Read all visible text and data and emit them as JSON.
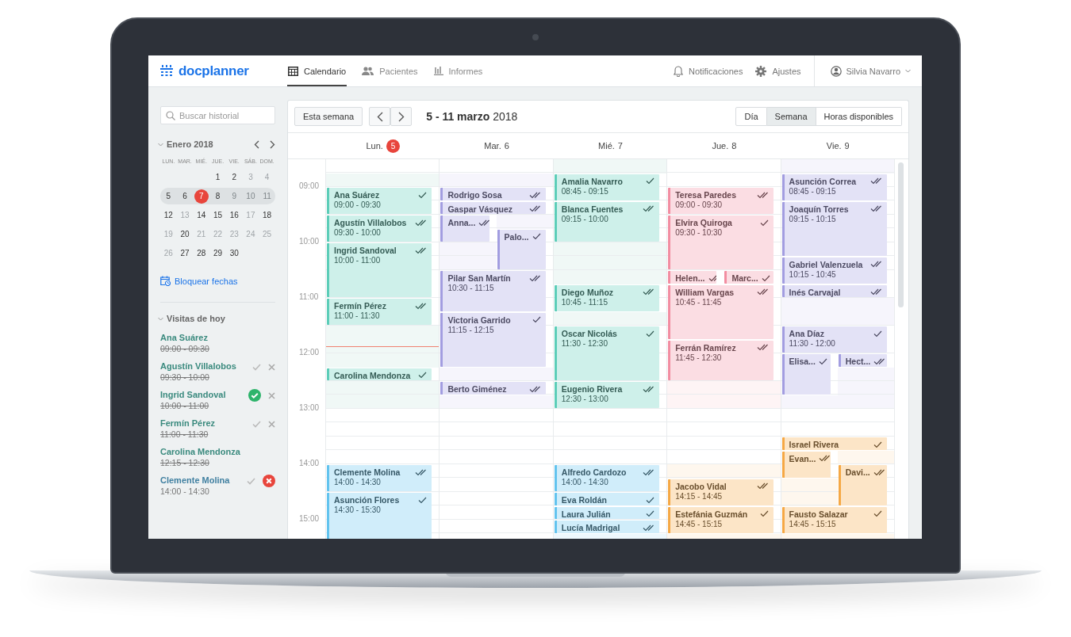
{
  "header": {
    "logo": "docplanner",
    "nav": [
      {
        "label": "Calendario",
        "selected": true
      },
      {
        "label": "Pacientes",
        "selected": false
      },
      {
        "label": "Informes",
        "selected": false
      }
    ],
    "notifications": "Notificaciones",
    "settings": "Ajustes",
    "user": "Silvia Navarro"
  },
  "sidebar": {
    "search": {
      "placeholder": "Buscar historial"
    },
    "month": "Enero 2018",
    "weekdays": [
      "LUN.",
      "MAR.",
      "MIÉ.",
      "JUE.",
      "VIE.",
      "SÁB.",
      "DOM."
    ],
    "weeks": [
      {
        "current": false,
        "days": [
          {
            "d": "1",
            "muted": false,
            "selected": false
          },
          {
            "d": "2",
            "muted": false,
            "selected": false
          },
          {
            "d": "3",
            "muted": true,
            "selected": false
          },
          {
            "d": "4",
            "muted": true,
            "selected": false
          }
        ]
      },
      {
        "current": true,
        "days": [
          {
            "d": "5",
            "muted": false,
            "selected": false
          },
          {
            "d": "6",
            "muted": false,
            "selected": false
          },
          {
            "d": "7",
            "muted": false,
            "selected": true
          },
          {
            "d": "8",
            "muted": false,
            "selected": false
          },
          {
            "d": "9",
            "muted": true,
            "selected": false
          },
          {
            "d": "10",
            "muted": true,
            "selected": false
          },
          {
            "d": "11",
            "muted": true,
            "selected": false
          }
        ]
      },
      {
        "current": false,
        "days": [
          {
            "d": "12",
            "muted": false,
            "selected": false
          },
          {
            "d": "13",
            "muted": true,
            "selected": false
          },
          {
            "d": "14",
            "muted": false,
            "selected": false
          },
          {
            "d": "15",
            "muted": false,
            "selected": false
          },
          {
            "d": "16",
            "muted": false,
            "selected": false
          },
          {
            "d": "17",
            "muted": true,
            "selected": false
          },
          {
            "d": "18",
            "muted": false,
            "selected": false
          }
        ]
      },
      {
        "current": false,
        "days": [
          {
            "d": "19",
            "muted": true,
            "selected": false
          },
          {
            "d": "20",
            "muted": false,
            "selected": false
          },
          {
            "d": "21",
            "muted": true,
            "selected": false
          },
          {
            "d": "22",
            "muted": true,
            "selected": false
          },
          {
            "d": "23",
            "muted": true,
            "selected": false
          },
          {
            "d": "24",
            "muted": true,
            "selected": false
          },
          {
            "d": "25",
            "muted": true,
            "selected": false
          }
        ]
      },
      {
        "current": false,
        "days": [
          {
            "d": "26",
            "muted": true,
            "selected": false
          },
          {
            "d": "27",
            "muted": false,
            "selected": false
          },
          {
            "d": "28",
            "muted": false,
            "selected": false
          },
          {
            "d": "29",
            "muted": false,
            "selected": false
          },
          {
            "d": "30",
            "muted": false,
            "selected": false
          }
        ]
      }
    ],
    "block_dates": "Bloquear fechas",
    "visits_title": "Visitas de hoy",
    "visits": [
      {
        "name": "Ana Suárez",
        "time": "09:00 - 09:30",
        "done": true,
        "actions": false,
        "color": "#3a8a7e"
      },
      {
        "name": "Agustín Villalobos",
        "time": "09:30 - 10:00",
        "done": true,
        "actions": true,
        "accepted": false,
        "rejected": false,
        "color": "#3a8a7e"
      },
      {
        "name": "Ingrid Sandoval",
        "time": "10:00 - 11:00",
        "done": true,
        "actions": true,
        "accepted": true,
        "rejected": false,
        "color": "#3a8a7e"
      },
      {
        "name": "Fermín Pérez",
        "time": "11:00 - 11:30",
        "done": true,
        "actions": true,
        "accepted": false,
        "rejected": false,
        "color": "#3a8a7e"
      },
      {
        "name": "Carolina Mendonza",
        "time": "12:15 - 12:30",
        "done": true,
        "actions": false,
        "color": "#3a8a7e"
      },
      {
        "name": "Clemente Molina",
        "time": "14:00 - 14:30",
        "done": false,
        "actions": true,
        "accepted": false,
        "rejected": true,
        "color": "#3f7fa0"
      }
    ]
  },
  "calendar": {
    "this_week": "Esta semana",
    "title": "**5 - 11 marzo** 2018",
    "views": [
      {
        "label": "Día",
        "selected": false
      },
      {
        "label": "Semana",
        "selected": true
      },
      {
        "label": "Horas disponibles",
        "selected": false
      }
    ],
    "hours": [
      "09:00",
      "10:00",
      "11:00",
      "12:00",
      "13:00",
      "14:00",
      "15:00"
    ],
    "days": [
      {
        "label": "Lun.",
        "date": "5",
        "highlighted": true,
        "slots": [
          {
            "kind": "gap"
          },
          {
            "kind": "gap",
            "color": "#f0f8f6"
          },
          {
            "kind": "wide",
            "name": "Ana Suárez",
            "time": "09:00 - 09:30",
            "double_check": false,
            "color": "#5ccdb8"
          },
          {
            "kind": "wide",
            "name": "Agustín Villalobos",
            "time": "09:30 - 10:00",
            "double_check": true,
            "color": "#5ccdb8"
          },
          {
            "kind": "wide",
            "name": "Ingrid Sandoval",
            "time": "10:00 - 11:00",
            "double_check": true,
            "color": "#5ccdb8"
          },
          {
            "kind": "wide",
            "name": "Fermín Pérez",
            "time": "11:00 - 11:30",
            "double_check": true,
            "color": "#5ccdb8"
          },
          {
            "kind": "gap",
            "color": "#f0f8f6"
          },
          {
            "kind": "nowline",
            "color": "#f0f8f6"
          },
          {
            "kind": "gap",
            "color": "#f0f8f6"
          },
          {
            "kind": "wide",
            "name": "Carolina Mendonza",
            "double_check": false,
            "color": "#5ccdb8"
          },
          {
            "kind": "gap",
            "color": "#f0f8f6"
          },
          {
            "kind": "gap",
            "color": "#f0f8f6"
          },
          {
            "kind": "gap"
          },
          {
            "kind": "gap"
          },
          {
            "kind": "gap"
          },
          {
            "kind": "gap"
          },
          {
            "kind": "wide",
            "name": "Clemente Molina",
            "time": "14:00 - 14:30",
            "double_check": true,
            "color": "#62c3ee"
          },
          {
            "kind": "wide",
            "name": "Asunción Flores",
            "time": "14:30 - 15:30",
            "double_check": false,
            "color": "#62c3ee"
          }
        ]
      },
      {
        "label": "Mar.",
        "date": "6",
        "highlighted": false,
        "slots": [
          {
            "kind": "gap"
          },
          {
            "kind": "gap",
            "color": "#f6f5fc"
          },
          {
            "kind": "wide",
            "name": "Rodrigo Sosa",
            "double_check": true,
            "color": "#a29de0"
          },
          {
            "kind": "wide",
            "name": "Gaspar Vásquez",
            "double_check": true,
            "color": "#a29de0"
          },
          {
            "kind": "narrow-double",
            "name": "Anna...",
            "double_check": true,
            "color": "#a29de0"
          },
          {
            "kind": "halfgap",
            "color": "#f6f5fc"
          },
          {
            "kind": "narrow-triple",
            "name": "Palo...",
            "double_check": false,
            "color": "#a29de0"
          },
          {
            "kind": "halfgap",
            "color": "#f6f5fc"
          },
          {
            "kind": "halfgap",
            "color": "#f6f5fc"
          },
          {
            "kind": "wide",
            "name": "Pilar San Martín",
            "time": "10:30 - 11:15",
            "double_check": true,
            "color": "#a29de0"
          },
          {
            "kind": "wide",
            "name": "Victoria Garrido",
            "time": "11:15 - 12:15",
            "double_check": false,
            "color": "#a29de0"
          },
          {
            "kind": "gap",
            "color": "#f6f5fc"
          },
          {
            "kind": "wide",
            "name": "Berto Giménez",
            "double_check": true,
            "color": "#a29de0"
          },
          {
            "kind": "gap",
            "color": "#f6f5fc"
          }
        ]
      },
      {
        "label": "Mié.",
        "date": "7",
        "highlighted": false,
        "slots": [
          {
            "kind": "gap",
            "color": "#f0f8f6"
          },
          {
            "kind": "wide",
            "name": "Amalia Navarro",
            "time": "08:45 - 09:15",
            "double_check": false,
            "color": "#5ccdb8"
          },
          {
            "kind": "wide",
            "name": "Blanca Fuentes",
            "time": "09:15 - 10:00",
            "double_check": true,
            "color": "#5ccdb8"
          },
          {
            "kind": "gap",
            "color": "#f0f8f6"
          },
          {
            "kind": "gap",
            "color": "#f0f8f6"
          },
          {
            "kind": "gap",
            "color": "#f0f8f6"
          },
          {
            "kind": "wide",
            "name": "Diego Muñoz",
            "time": "10:45 - 11:15",
            "double_check": true,
            "color": "#5ccdb8"
          },
          {
            "kind": "gap",
            "color": "#f0f8f6"
          },
          {
            "kind": "wide",
            "name": "Oscar Nicolás",
            "time": "11:30 - 12:30",
            "double_check": false,
            "color": "#5ccdb8"
          },
          {
            "kind": "wide",
            "name": "Eugenio Rivera",
            "time": "12:30 - 13:00",
            "double_check": true,
            "color": "#5ccdb8"
          },
          {
            "kind": "gap"
          },
          {
            "kind": "gap"
          },
          {
            "kind": "gap"
          },
          {
            "kind": "gap"
          },
          {
            "kind": "wide",
            "name": "Alfredo Cardozo",
            "time": "14:00 - 14:30",
            "double_check": true,
            "color": "#62c3ee"
          },
          {
            "kind": "wide",
            "name": "Eva Roldán",
            "double_check": false,
            "color": "#62c3ee"
          },
          {
            "kind": "wide",
            "name": "Laura Julián",
            "double_check": false,
            "color": "#62c3ee"
          },
          {
            "kind": "wide",
            "name": "Lucía Madrigal",
            "double_check": true,
            "color": "#62c3ee"
          },
          {
            "kind": "gap",
            "color": "#eef8fd"
          }
        ]
      },
      {
        "label": "Jue.",
        "date": "8",
        "highlighted": false,
        "slots": [
          {
            "kind": "gap"
          },
          {
            "kind": "gap"
          },
          {
            "kind": "wide",
            "name": "Teresa Paredes",
            "time": "09:00 - 09:30",
            "double_check": true,
            "color": "#f28da1"
          },
          {
            "kind": "wide",
            "name": "Elvira Quiroga",
            "time": "09:30 - 10:30",
            "double_check": false,
            "color": "#f28da1"
          },
          {
            "kind": "narrow",
            "name": "Helen...",
            "double_check": true,
            "color": "#f28da1"
          },
          {
            "kind": "narrow",
            "name": "Marc...",
            "double_check": false,
            "color": "#f28da1"
          },
          {
            "kind": "wide",
            "name": "William Vargas",
            "time": "10:45 - 11:45",
            "double_check": true,
            "color": "#f28da1"
          },
          {
            "kind": "wide",
            "name": "Ferrán Ramírez",
            "time": "11:45 - 12:30",
            "double_check": true,
            "color": "#f28da1"
          },
          {
            "kind": "gap",
            "color": "#fef4f5"
          },
          {
            "kind": "gap",
            "color": "#fef4f5"
          },
          {
            "kind": "gap"
          },
          {
            "kind": "gap"
          },
          {
            "kind": "gap"
          },
          {
            "kind": "gap"
          },
          {
            "kind": "gap",
            "color": "#fef7ee"
          },
          {
            "kind": "wide",
            "name": "Jacobo Vidal",
            "time": "14:15 - 14:45",
            "double_check": true,
            "color": "#f5a845"
          },
          {
            "kind": "wide",
            "name": "Estefánia Guzmán",
            "time": "14:45 - 15:15",
            "double_check": false,
            "color": "#f5a845"
          },
          {
            "kind": "gap",
            "color": "#fef7ee"
          }
        ]
      },
      {
        "label": "Vie.",
        "date": "9",
        "highlighted": false,
        "slots": [
          {
            "kind": "gap",
            "color": "#f6f5fc"
          },
          {
            "kind": "wide",
            "name": "Asunción Correa",
            "time": "08:45 - 09:15",
            "double_check": true,
            "color": "#a29de0"
          },
          {
            "kind": "wide",
            "name": "Joaquín Torres",
            "time": "09:15 - 10:15",
            "double_check": true,
            "color": "#a29de0"
          },
          {
            "kind": "wide",
            "name": "Gabriel Valenzuela",
            "time": "10:15 - 10:45",
            "double_check": true,
            "color": "#a29de0"
          },
          {
            "kind": "wide",
            "name": "Inés Carvajal",
            "double_check": true,
            "color": "#a29de0"
          },
          {
            "kind": "gap",
            "color": "#f6f5fc"
          },
          {
            "kind": "gap",
            "color": "#f6f5fc"
          },
          {
            "kind": "wide",
            "name": "Ana Díaz",
            "time": "11:30 - 12:00",
            "double_check": false,
            "color": "#a29de0"
          },
          {
            "kind": "narrow-triple",
            "name": "Elisa...",
            "double_check": false,
            "color": "#a29de0"
          },
          {
            "kind": "narrow",
            "name": "Hect...",
            "double_check": true,
            "color": "#a29de0"
          },
          {
            "kind": "halfgap",
            "color": "#f6f5fc"
          },
          {
            "kind": "halfgap",
            "color": "#f6f5fc"
          },
          {
            "kind": "gap",
            "color": "#f6f5fc"
          },
          {
            "kind": "gap"
          },
          {
            "kind": "gap"
          },
          {
            "kind": "wide",
            "name": "Israel Rivera",
            "double_check": false,
            "color": "#f5a845"
          },
          {
            "kind": "narrow-double",
            "name": "Evan...",
            "double_check": true,
            "color": "#f5a845"
          },
          {
            "kind": "halfgap",
            "color": "#fef7ee"
          },
          {
            "kind": "narrow-triple",
            "name": "Davi...",
            "double_check": true,
            "color": "#f5a845"
          },
          {
            "kind": "halfgap",
            "color": "#fef7ee"
          },
          {
            "kind": "halfgap",
            "color": "#fef7ee"
          },
          {
            "kind": "wide",
            "name": "Fausto Salazar",
            "time": "14:45 - 15:15",
            "double_check": false,
            "color": "#f5a845"
          },
          {
            "kind": "gap",
            "color": "#fef7ee"
          }
        ]
      }
    ]
  }
}
